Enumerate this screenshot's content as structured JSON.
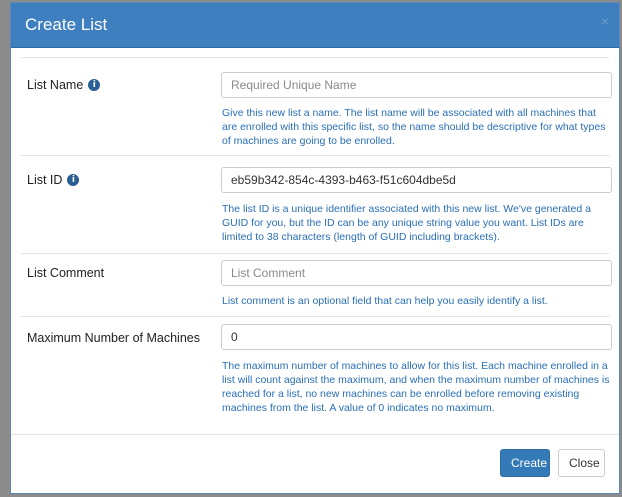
{
  "dialog": {
    "title": "Create List",
    "close_glyph": "×"
  },
  "fields": {
    "list_name": {
      "label": "List Name",
      "info_icon": "info-icon",
      "value": "",
      "placeholder": "Required Unique Name",
      "help": "Give this new list a name. The list name will be associated with all machines that are enrolled with this specific list, so the name should be descriptive for what types of machines are going to be enrolled."
    },
    "list_id": {
      "label": "List ID",
      "info_icon": "info-icon",
      "value": "eb59b342-854c-4393-b463-f51c604dbe5d",
      "help": "The list ID is a unique identifier associated with this new list. We've generated a GUID for you, but the ID can be any unique string value you want. List IDs are limited to 38 characters (length of GUID including brackets)."
    },
    "list_comment": {
      "label": "List Comment",
      "value": "",
      "placeholder": "List Comment",
      "help": "List comment is an optional field that can help you easily identify a list."
    },
    "max_machines": {
      "label": "Maximum Number of Machines",
      "value": "0",
      "help": "The maximum number of machines to allow for this list. Each machine enrolled in a list will count against the maximum, and when the maximum number of machines is reached for a list, no new machines can be enrolled before removing existing machines from the list. A value of 0 indicates no maximum."
    }
  },
  "footer": {
    "create_label": "Create",
    "close_label": "Close"
  },
  "colors": {
    "header": "#3d7fbf",
    "help_text": "#2a6fb5",
    "primary_button": "#337ab7",
    "info_icon": "#2a5f95"
  }
}
